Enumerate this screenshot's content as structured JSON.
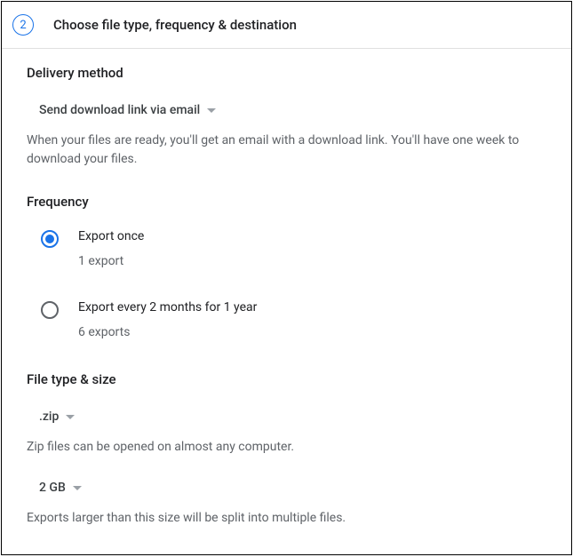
{
  "header": {
    "step_number": "2",
    "title": "Choose file type, frequency & destination"
  },
  "delivery": {
    "section_title": "Delivery method",
    "dropdown_label": "Send download link via email",
    "help_text": "When your files are ready, you'll get an email with a download link. You'll have one week to download your files."
  },
  "frequency": {
    "section_title": "Frequency",
    "option1": {
      "label": "Export once",
      "sublabel": "1 export"
    },
    "option2": {
      "label": "Export every 2 months for 1 year",
      "sublabel": "6 exports"
    }
  },
  "filetype": {
    "section_title": "File type & size",
    "type_dropdown_label": ".zip",
    "type_help_text": "Zip files can be opened on almost any computer.",
    "size_dropdown_label": "2 GB",
    "size_help_text": "Exports larger than this size will be split into multiple files."
  }
}
